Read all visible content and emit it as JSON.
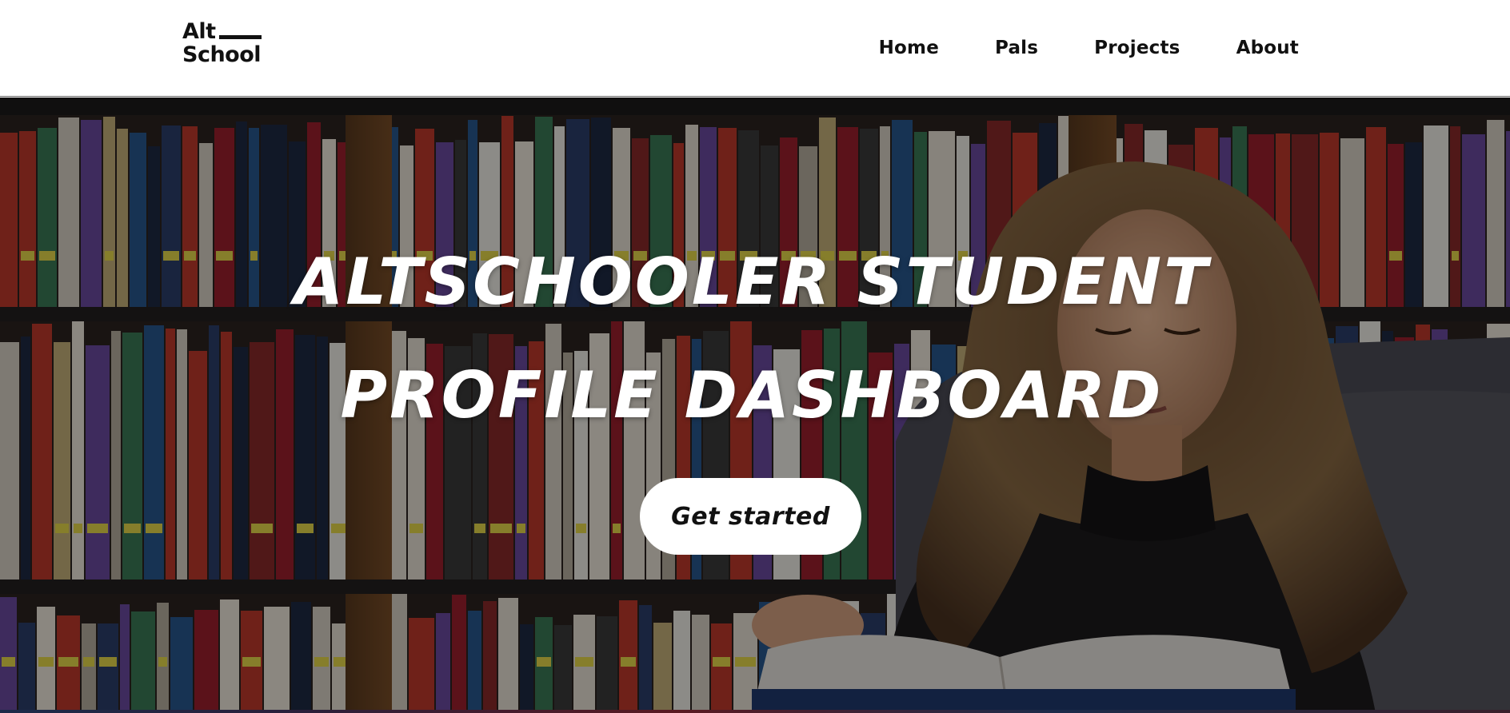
{
  "logo": {
    "line1": "Alt",
    "line2": "School"
  },
  "nav": [
    {
      "label": "Home"
    },
    {
      "label": "Pals"
    },
    {
      "label": "Projects"
    },
    {
      "label": "About"
    }
  ],
  "hero": {
    "title": "ALTSCHOOLER STUDENT PROFILE DASHBOARD",
    "cta_label": "Get started"
  },
  "colors": {
    "header_bg": "#ffffff",
    "text_dark": "#111111",
    "cta_bg": "#ffffff",
    "hero_text": "#ffffff"
  }
}
